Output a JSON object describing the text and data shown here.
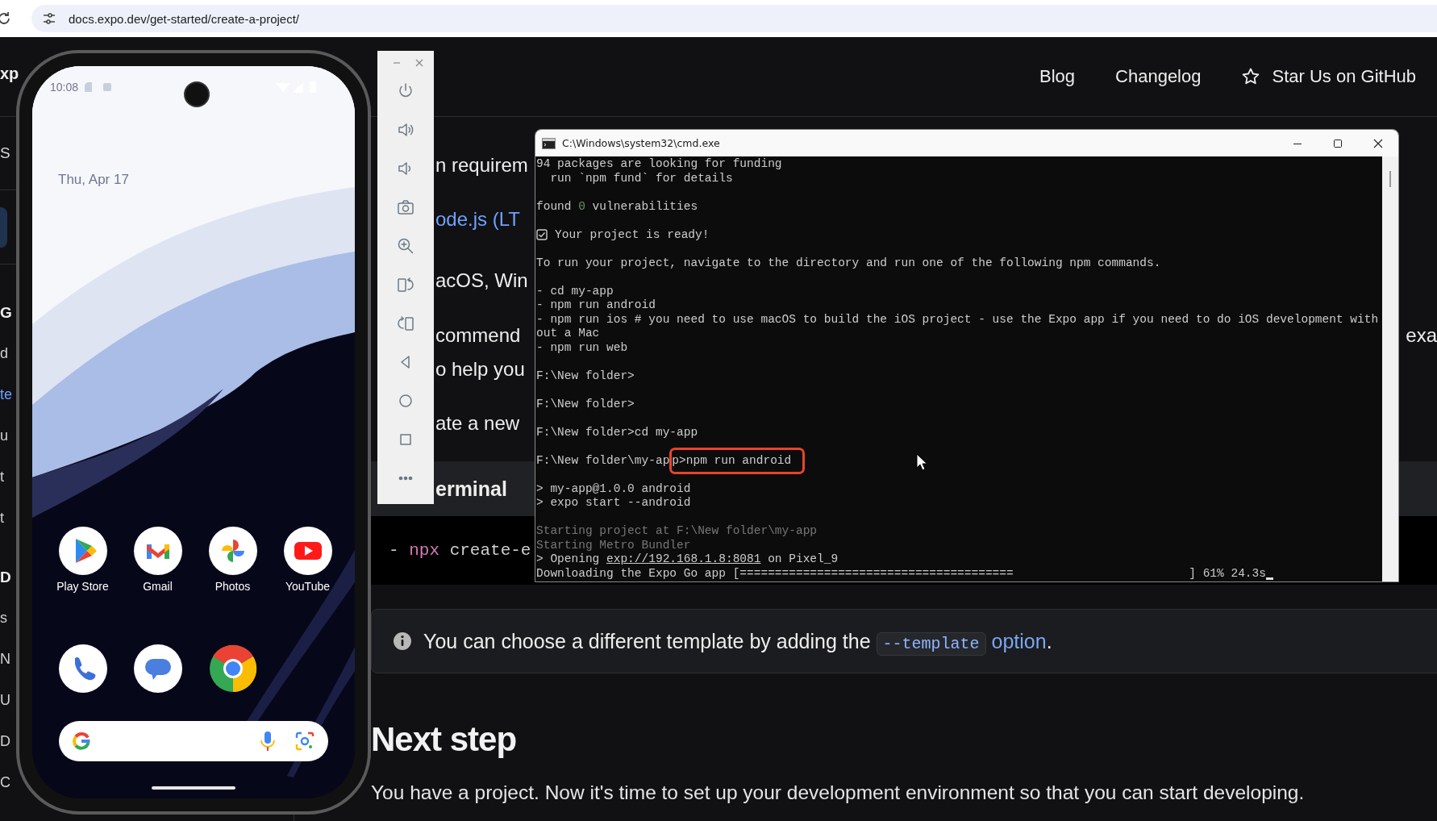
{
  "browser": {
    "url": "docs.expo.dev/get-started/create-a-project/"
  },
  "header": {
    "logo": "xp",
    "nav": [
      {
        "label": "Blog",
        "kind": "link"
      },
      {
        "label": "Changelog",
        "kind": "link"
      },
      {
        "label": "Star Us on GitHub",
        "kind": "github"
      }
    ]
  },
  "sidebar": {
    "items": [
      {
        "kind": "search",
        "text": "S"
      },
      {
        "kind": "button"
      },
      {
        "kind": "section",
        "text": "G"
      },
      {
        "kind": "item",
        "text": "d",
        "selected": false
      },
      {
        "kind": "item",
        "text": "te",
        "selected": true
      },
      {
        "kind": "item",
        "text": "u",
        "selected": false
      },
      {
        "kind": "item",
        "text": "t",
        "selected": false
      },
      {
        "kind": "item",
        "text": "t",
        "selected": false
      },
      {
        "kind": "section",
        "text": "D"
      },
      {
        "kind": "item",
        "text": "s",
        "selected": false
      },
      {
        "kind": "item",
        "text": "N",
        "selected": false
      },
      {
        "kind": "item",
        "text": "U",
        "selected": false
      },
      {
        "kind": "item",
        "text": "D",
        "selected": false
      },
      {
        "kind": "item",
        "text": "C",
        "selected": false
      }
    ]
  },
  "doc": {
    "lines": [
      {
        "kind": "text",
        "text": "n requirem"
      },
      {
        "kind": "link",
        "text": "ode.js (LT"
      },
      {
        "kind": "text",
        "text": "acOS, Win"
      },
      {
        "kind": "text",
        "text": "commend",
        "right": "exa"
      },
      {
        "kind": "text",
        "text": "o help you"
      },
      {
        "kind": "text",
        "text": "ate a new"
      }
    ],
    "code_block": {
      "title": "erminal",
      "parts": [
        {
          "text": "- ",
          "kind": "plain"
        },
        {
          "text": "npx",
          "kind": "keyword"
        },
        {
          "text": " create-e",
          "kind": "plain"
        }
      ]
    },
    "callout": {
      "text": "You can choose a different template by adding the",
      "code": "--template",
      "link": "option",
      "after": "."
    },
    "heading": "Next step",
    "paragraph": "You have a project. Now it's time to set up your development environment so that you can start developing."
  },
  "phone": {
    "time": "10:08",
    "date": "Thu, Apr 17",
    "apps": [
      {
        "kind": "play",
        "label": "Play Store"
      },
      {
        "kind": "gmail",
        "label": "Gmail"
      },
      {
        "kind": "photos",
        "label": "Photos"
      },
      {
        "kind": "youtube",
        "label": "YouTube"
      }
    ],
    "dock": [
      {
        "kind": "phone"
      },
      {
        "kind": "messages"
      },
      {
        "kind": "chrome"
      }
    ]
  },
  "terminal": {
    "title": "C:\\Windows\\system32\\cmd.exe",
    "lines": [
      {
        "kind": "text",
        "parts": [
          {
            "text": "94 packages are looking for funding"
          }
        ]
      },
      {
        "kind": "text",
        "parts": [
          {
            "text": "  run `npm fund` for details"
          }
        ]
      },
      {
        "kind": "blank"
      },
      {
        "kind": "text",
        "parts": [
          {
            "text": "found "
          },
          {
            "text": "0",
            "kind": "green"
          },
          {
            "text": " vulnerabilities"
          }
        ]
      },
      {
        "kind": "blank"
      },
      {
        "kind": "check",
        "parts": [
          {
            "text": "Your project is ready!"
          }
        ]
      },
      {
        "kind": "blank"
      },
      {
        "kind": "text",
        "parts": [
          {
            "text": "To run your project, navigate to the directory and run one of the following npm commands."
          }
        ]
      },
      {
        "kind": "blank"
      },
      {
        "kind": "text",
        "parts": [
          {
            "text": "- cd my-app"
          }
        ]
      },
      {
        "kind": "text",
        "parts": [
          {
            "text": "- npm run android"
          }
        ]
      },
      {
        "kind": "text",
        "parts": [
          {
            "text": "- npm run ios # you need to use macOS to build the iOS project - use the Expo app if you need to do iOS development with"
          }
        ]
      },
      {
        "kind": "text",
        "parts": [
          {
            "text": "out a Mac"
          }
        ]
      },
      {
        "kind": "text",
        "parts": [
          {
            "text": "- npm run web"
          }
        ]
      },
      {
        "kind": "blank"
      },
      {
        "kind": "text",
        "parts": [
          {
            "text": "F:\\New folder>"
          }
        ]
      },
      {
        "kind": "blank"
      },
      {
        "kind": "text",
        "parts": [
          {
            "text": "F:\\New folder>"
          }
        ]
      },
      {
        "kind": "blank"
      },
      {
        "kind": "text",
        "parts": [
          {
            "text": "F:\\New folder>cd my-app"
          }
        ]
      },
      {
        "kind": "blank"
      },
      {
        "kind": "text",
        "parts": [
          {
            "text": "F:\\New folder\\my-ap"
          },
          {
            "text": "p>npm run android",
            "kind": "boxed"
          }
        ]
      },
      {
        "kind": "blank"
      },
      {
        "kind": "text",
        "parts": [
          {
            "text": "> my-app@1.0.0 android"
          }
        ]
      },
      {
        "kind": "text",
        "parts": [
          {
            "text": "> expo start --android"
          }
        ]
      },
      {
        "kind": "blank"
      },
      {
        "kind": "text",
        "parts": [
          {
            "text": "Starting project at F:\\New folder\\my-app",
            "kind": "dim"
          }
        ]
      },
      {
        "kind": "text",
        "parts": [
          {
            "text": "Starting Metro Bundler",
            "kind": "dim"
          }
        ]
      },
      {
        "kind": "text",
        "parts": [
          {
            "text": "> Opening "
          },
          {
            "text": "exp://192.168.1.8:8081",
            "kind": "link"
          },
          {
            "text": " on Pixel_9"
          }
        ]
      },
      {
        "kind": "text",
        "cursor": true,
        "parts": [
          {
            "text": "Downloading the Expo Go app [=======================================                         ] 61% 24.3s"
          }
        ]
      }
    ]
  }
}
